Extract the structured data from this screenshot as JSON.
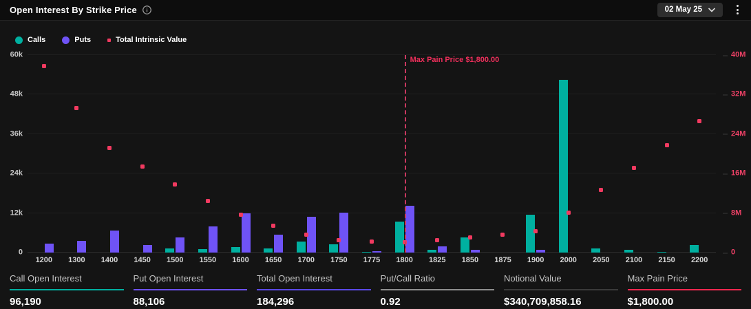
{
  "header": {
    "title": "Open Interest By Strike Price",
    "date_selector": "02 May 25"
  },
  "legend": [
    {
      "label": "Calls",
      "color": "#00b0a0",
      "shape": "circle"
    },
    {
      "label": "Puts",
      "color": "#6f53f6",
      "shape": "circle"
    },
    {
      "label": "Total Intrinsic Value",
      "color": "#f23a60",
      "shape": "square"
    }
  ],
  "chart_data": {
    "type": "bar",
    "title": "Open Interest By Strike Price",
    "categories": [
      1200,
      1300,
      1400,
      1450,
      1500,
      1550,
      1600,
      1650,
      1700,
      1750,
      1775,
      1800,
      1825,
      1850,
      1875,
      1900,
      2000,
      2050,
      2100,
      2150,
      2200
    ],
    "series": [
      {
        "name": "Calls",
        "type": "bar",
        "axis": "left",
        "color": "#00b0a0",
        "unit": "contracts",
        "values": [
          0,
          0,
          0,
          0,
          1200,
          1000,
          1600,
          1200,
          3300,
          2600,
          300,
          9400,
          900,
          4500,
          0,
          11500,
          52400,
          1200,
          800,
          200,
          2300
        ]
      },
      {
        "name": "Puts",
        "type": "bar",
        "axis": "left",
        "color": "#6f53f6",
        "unit": "contracts",
        "values": [
          2800,
          3500,
          6600,
          2200,
          4500,
          8000,
          12000,
          5400,
          10900,
          12100,
          500,
          14200,
          1800,
          900,
          0,
          800,
          0,
          0,
          0,
          0,
          0
        ]
      },
      {
        "name": "Total Intrinsic Value",
        "type": "scatter",
        "axis": "right",
        "color": "#f23a60",
        "unit": "USD millions",
        "values": [
          37.8,
          29.3,
          21.2,
          17.4,
          13.8,
          10.5,
          7.7,
          5.5,
          3.6,
          2.5,
          2.2,
          2.1,
          2.5,
          3.0,
          3.6,
          4.3,
          8.1,
          12.7,
          17.1,
          21.7,
          26.6
        ]
      }
    ],
    "left_axis": {
      "ticks": [
        "0",
        "12k",
        "24k",
        "36k",
        "48k",
        "60k"
      ],
      "max": 60000
    },
    "right_axis": {
      "ticks": [
        "0",
        "8M",
        "16M",
        "24M",
        "32M",
        "40M"
      ],
      "max": 40
    },
    "annotation": {
      "text": "Max Pain Price $1,800.00",
      "strike": 1800
    },
    "legend_position": "top",
    "grid": "horizontal"
  },
  "stats": [
    {
      "label": "Call Open Interest",
      "value": "96,190",
      "accent": "#00b0a0"
    },
    {
      "label": "Put Open Interest",
      "value": "88,106",
      "accent": "#6f53f6"
    },
    {
      "label": "Total Open Interest",
      "value": "184,296",
      "accent": "#5b49e8"
    },
    {
      "label": "Put/Call Ratio",
      "value": "0.92",
      "accent": "#8f8f8f"
    },
    {
      "label": "Notional Value",
      "value": "$340,709,858.16",
      "accent": "#3a3a3a"
    },
    {
      "label": "Max Pain Price",
      "value": "$1,800.00",
      "accent": "#f02950"
    }
  ]
}
